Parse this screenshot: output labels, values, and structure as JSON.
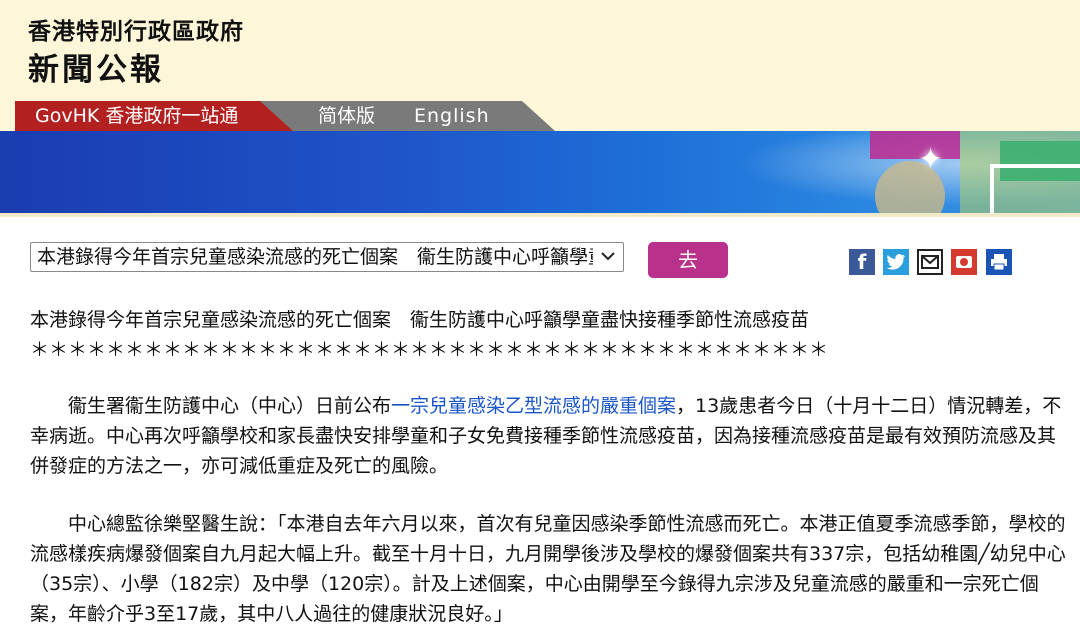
{
  "header": {
    "gov_name": "香港特別行政區政府",
    "press_title": "新聞公報"
  },
  "nav": {
    "govhk_label": "GovHK 香港政府一站通",
    "simplified_label": "简体版",
    "english_label": "English"
  },
  "controls": {
    "selected_article": "本港錄得今年首宗兒童感染流感的死亡個案　衞生防護中心呼籲學童盡快接種季節性流感疫苗",
    "go_label": "去"
  },
  "share_icons": [
    "facebook-icon",
    "twitter-icon",
    "email-icon",
    "weibo-icon",
    "print-icon"
  ],
  "share_facebook_glyph": "f",
  "article": {
    "headline": "本港錄得今年首宗兒童感染流感的死亡個案　衞生防護中心呼籲學童盡快接種季節性流感疫苗",
    "stars": "＊＊＊＊＊＊＊＊＊＊＊＊＊＊＊＊＊＊＊＊＊＊＊＊＊＊＊＊＊＊＊＊＊＊＊＊＊＊＊＊＊＊",
    "p1_before": "衞生署衞生防護中心（中心）日前公布",
    "p1_link": "一宗兒童感染乙型流感的嚴重個案",
    "p1_after": "，13歲患者今日（十月十二日）情況轉差，不幸病逝。中心再次呼籲學校和家長盡快安排學童和子女免費接種季節性流感疫苗，因為接種流感疫苗是最有效預防流感及其併發症的方法之一，亦可減低重症及死亡的風險。",
    "p2": "中心總監徐樂堅醫生說：「本港自去年六月以來，首次有兒童因感染季節性流感而死亡。本港正值夏季流感季節，學校的流感樣疾病爆發個案自九月起大幅上升。截至十月十日，九月開學後涉及學校的爆發個案共有337宗，包括幼稚園╱幼兒中心（35宗）、小學（182宗）及中學（120宗）。計及上述個案，中心由開學至今錄得九宗涉及兒童流感的嚴重和一宗死亡個案，年齡介乎3至17歲，其中八人過往的健康狀況良好。」"
  },
  "colors": {
    "header_bg": "#fdf6d8",
    "govhk_tab": "#b32020",
    "lang_tab": "#7a7a7a",
    "go_button": "#b8328c",
    "link": "#1a55c8",
    "banner_blue": "#1f52c8"
  }
}
